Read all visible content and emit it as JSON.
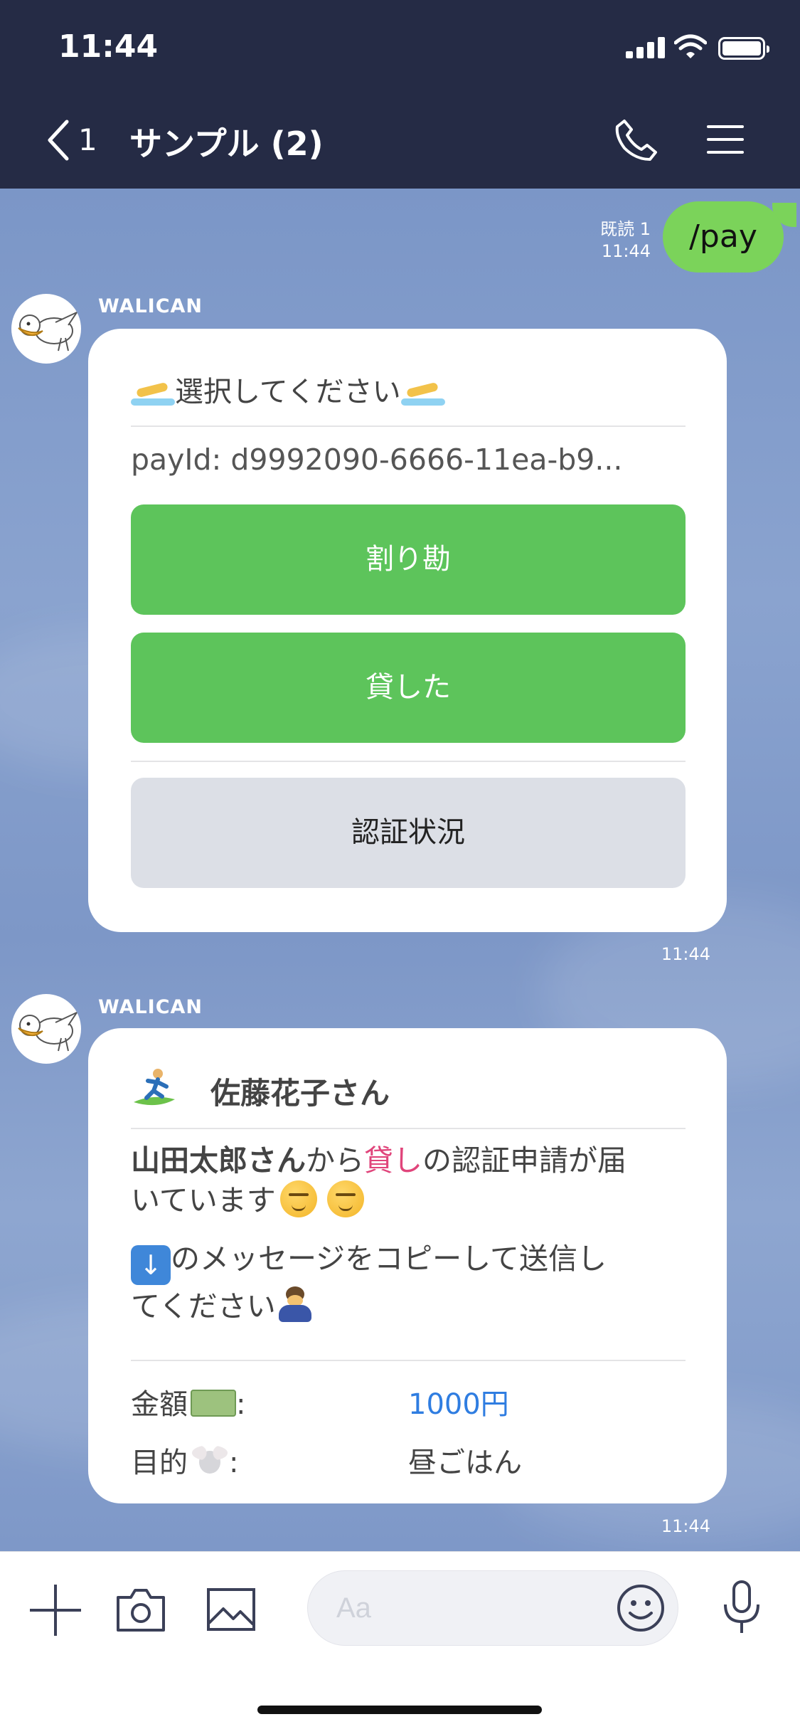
{
  "status_bar": {
    "time": "11:44"
  },
  "nav": {
    "back_count": "1",
    "title": "サンプル (2)"
  },
  "messages": {
    "mine": {
      "text": "/pay",
      "read_label": "既読 1",
      "time": "11:44"
    },
    "card1": {
      "sender": "WALICAN",
      "title": "選択してください",
      "pay_id": "payId: d9992090-6666-11ea-b9...",
      "buttons": [
        "割り勘",
        "貸した",
        "認証状況"
      ],
      "time": "11:44"
    },
    "card2": {
      "sender": "WALICAN",
      "recipient": "佐藤花子さん",
      "requester": "山田太郎さん",
      "from_word": "から",
      "kind": "貸し",
      "line1_rest": "の認証申請が届",
      "line2": "いています",
      "line3": "のメッセージをコピーして送信し",
      "line4": "てください",
      "amount_label": ":",
      "amount_label_text": "金額",
      "amount_value": "1000円",
      "purpose_label_text": "目的",
      "purpose_label": ":",
      "purpose_value": "昼ごはん",
      "time": "11:44"
    }
  },
  "input": {
    "placeholder": "Aa"
  },
  "colors": {
    "accent_green": "#5dc45b",
    "bubble_green": "#7bd35a",
    "nav_bg": "#252b45",
    "pink": "#e0457b",
    "link_blue": "#2f7de1"
  }
}
